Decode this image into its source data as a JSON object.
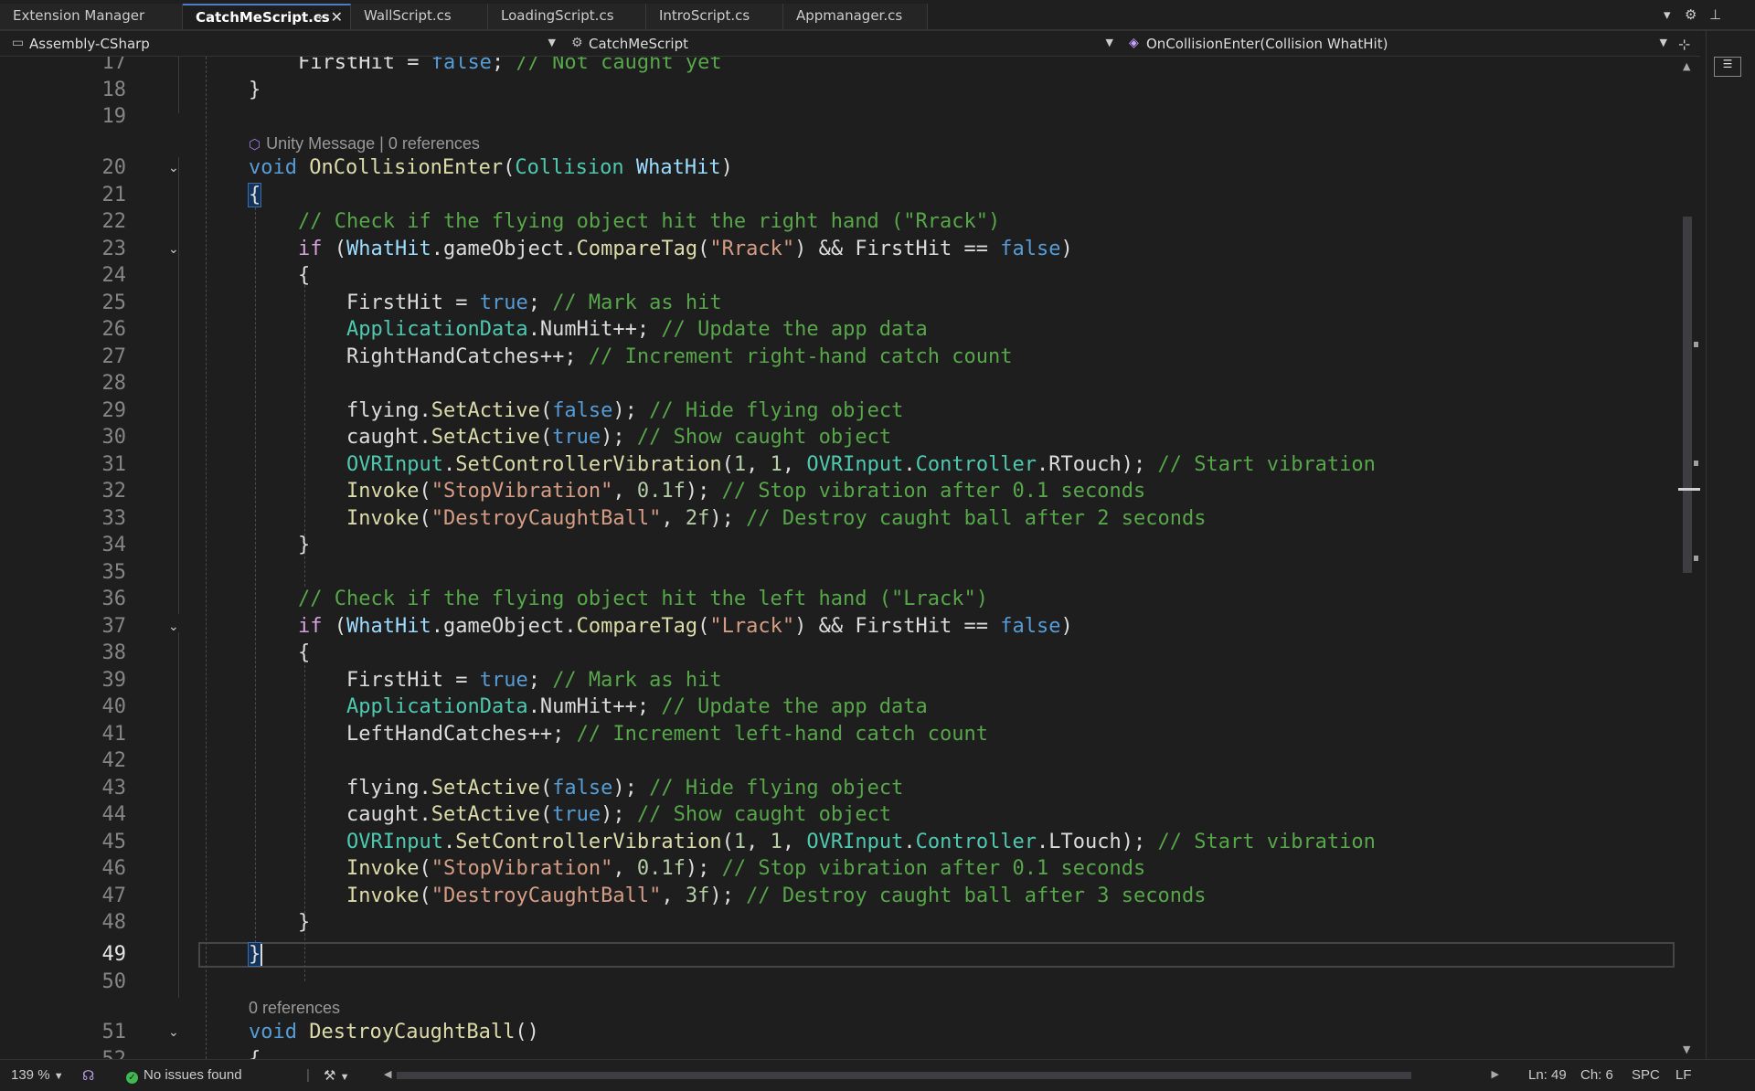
{
  "tabs": [
    {
      "label": "Extension Manager",
      "active": false
    },
    {
      "label": "CatchMeScript.cs",
      "active": true
    },
    {
      "label": "WallScript.cs",
      "active": false
    },
    {
      "label": "LoadingScript.cs",
      "active": false
    },
    {
      "label": "IntroScript.cs",
      "active": false
    },
    {
      "label": "Appmanager.cs",
      "active": false
    }
  ],
  "nav": {
    "project": "Assembly-CSharp",
    "class": "CatchMeScript",
    "member": "OnCollisionEnter(Collision WhatHit)"
  },
  "editor": {
    "code_lens_method": "Unity Message | 0 references",
    "code_lens_destroy": "0 references",
    "line_numbers": [
      "17",
      "18",
      "19",
      "20",
      "21",
      "22",
      "23",
      "24",
      "25",
      "26",
      "27",
      "28",
      "29",
      "30",
      "31",
      "32",
      "33",
      "34",
      "35",
      "36",
      "37",
      "38",
      "39",
      "40",
      "41",
      "42",
      "43",
      "44",
      "45",
      "46",
      "47",
      "48",
      "49",
      "50",
      "51",
      "52"
    ],
    "current_line": "49"
  },
  "status": {
    "zoom": "139 %",
    "issues": "No issues found",
    "line": "Ln: 49",
    "col": "Ch: 6",
    "indent": "SPC",
    "eol": "LF"
  },
  "colors": {
    "background": "#1e1e1e",
    "keyword": "#569cd6",
    "type": "#4ec9b0",
    "method": "#dcdcaa",
    "string": "#d69d85",
    "comment": "#57a64a",
    "ok": "#3fb950"
  }
}
